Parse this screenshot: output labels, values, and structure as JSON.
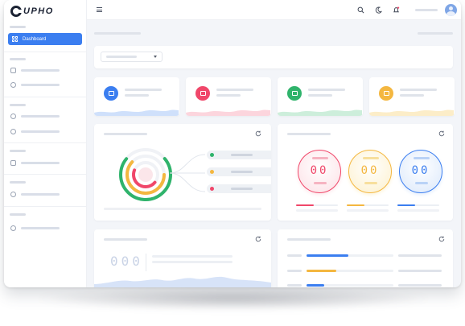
{
  "brand": {
    "name": "UPHO"
  },
  "sidebar": {
    "active_label": "Dashboard",
    "items": [
      {
        "icon": "cube-icon"
      },
      {
        "icon": "target-icon"
      },
      {
        "icon": "disc-icon"
      },
      {
        "icon": "plus-circle-icon"
      },
      {
        "icon": "document-icon"
      },
      {
        "icon": "pie-icon"
      },
      {
        "icon": "user-icon"
      }
    ]
  },
  "header": {
    "icons": [
      "search-icon",
      "moon-icon",
      "bell-icon"
    ]
  },
  "stats": [
    {
      "icon": "screen-icon",
      "color": "#3b7ef0",
      "wave": "#cfe0fb"
    },
    {
      "icon": "chat-icon",
      "color": "#f0476a",
      "wave": "#fcd5dd"
    },
    {
      "icon": "id-card-icon",
      "color": "#2fb36b",
      "wave": "#cdeedb"
    },
    {
      "icon": "file-icon",
      "color": "#f4b740",
      "wave": "#fcedc8"
    }
  ],
  "gauges": [
    {
      "value": "00",
      "color": "#f0476a"
    },
    {
      "value": "00",
      "color": "#f4b740"
    },
    {
      "value": "00",
      "color": "#3b7ef0"
    }
  ],
  "ring_legend": [
    {
      "color": "#2fb36b"
    },
    {
      "color": "#f4b740"
    },
    {
      "color": "#f0476a"
    }
  ],
  "counter": {
    "value": "000"
  },
  "colors": {
    "accent": "#3b7ef0",
    "red": "#f0476a",
    "yellow": "#f4b740",
    "green": "#2fb36b"
  }
}
